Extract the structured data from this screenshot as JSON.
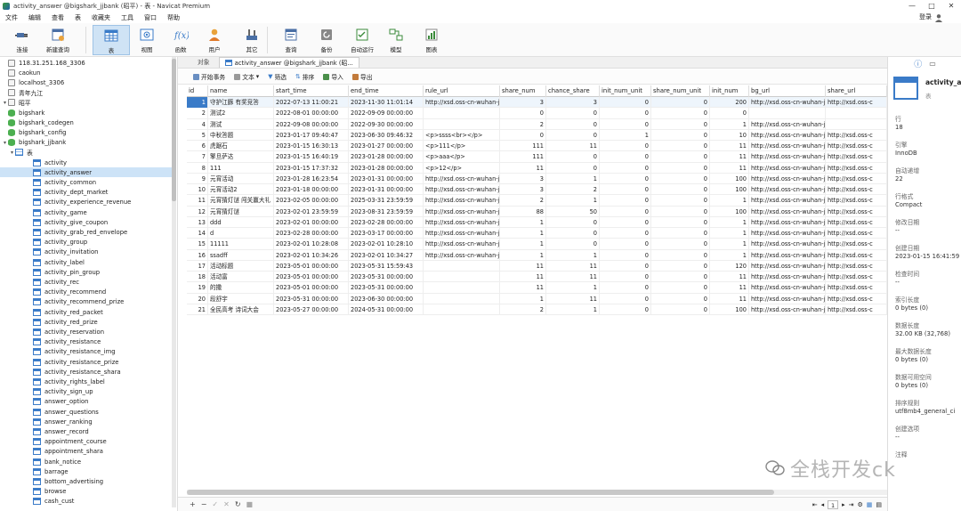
{
  "window": {
    "title": "activity_answer @bigshark_jjbank (昭平) - 表 - Navicat Premium",
    "min": "—",
    "max": "□",
    "close": "✕"
  },
  "menu": [
    "文件",
    "编辑",
    "查看",
    "表",
    "收藏夹",
    "工具",
    "窗口",
    "帮助"
  ],
  "login": "登录",
  "toolbar": {
    "items": [
      "连接",
      "新建查询",
      "表",
      "视图",
      "函数",
      "用户",
      "其它",
      "查询",
      "备份",
      "自动运行",
      "模型",
      "图表"
    ]
  },
  "tree": [
    {
      "label": "118.31.251.168_3306",
      "level": 0,
      "kind": "conn"
    },
    {
      "label": "caokun",
      "level": 0,
      "kind": "conn"
    },
    {
      "label": "localhost_3306",
      "level": 0,
      "kind": "conn"
    },
    {
      "label": "青年九江",
      "level": 0,
      "kind": "conn"
    },
    {
      "label": "昭平",
      "level": 0,
      "kind": "connopen",
      "tw": "▾"
    },
    {
      "label": "bigshark",
      "level": 1,
      "kind": "db"
    },
    {
      "label": "bigshark_codegen",
      "level": 1,
      "kind": "db"
    },
    {
      "label": "bigshark_config",
      "level": 1,
      "kind": "db"
    },
    {
      "label": "bigshark_jjbank",
      "level": 1,
      "kind": "dbopen",
      "tw": "▾"
    },
    {
      "label": "表",
      "level": 2,
      "kind": "tables",
      "tw": "▾"
    },
    {
      "label": "activity",
      "level": 3,
      "kind": "table"
    },
    {
      "label": "activity_answer",
      "level": 3,
      "kind": "table",
      "sel": true
    },
    {
      "label": "activity_common",
      "level": 3,
      "kind": "table"
    },
    {
      "label": "activity_dept_market",
      "level": 3,
      "kind": "table"
    },
    {
      "label": "activity_experience_revenue",
      "level": 3,
      "kind": "table"
    },
    {
      "label": "activity_game",
      "level": 3,
      "kind": "table"
    },
    {
      "label": "activity_give_coupon",
      "level": 3,
      "kind": "table"
    },
    {
      "label": "activity_grab_red_envelope",
      "level": 3,
      "kind": "table"
    },
    {
      "label": "activity_group",
      "level": 3,
      "kind": "table"
    },
    {
      "label": "activity_invitation",
      "level": 3,
      "kind": "table"
    },
    {
      "label": "activity_label",
      "level": 3,
      "kind": "table"
    },
    {
      "label": "activity_pin_group",
      "level": 3,
      "kind": "table"
    },
    {
      "label": "activity_rec",
      "level": 3,
      "kind": "table"
    },
    {
      "label": "activity_recommend",
      "level": 3,
      "kind": "table"
    },
    {
      "label": "activity_recommend_prize",
      "level": 3,
      "kind": "table"
    },
    {
      "label": "activity_red_packet",
      "level": 3,
      "kind": "table"
    },
    {
      "label": "activity_red_prize",
      "level": 3,
      "kind": "table"
    },
    {
      "label": "activity_reservation",
      "level": 3,
      "kind": "table"
    },
    {
      "label": "activity_resistance",
      "level": 3,
      "kind": "table"
    },
    {
      "label": "activity_resistance_img",
      "level": 3,
      "kind": "table"
    },
    {
      "label": "activity_resistance_prize",
      "level": 3,
      "kind": "table"
    },
    {
      "label": "activity_resistance_shara",
      "level": 3,
      "kind": "table"
    },
    {
      "label": "activity_rights_label",
      "level": 3,
      "kind": "table"
    },
    {
      "label": "activity_sign_up",
      "level": 3,
      "kind": "table"
    },
    {
      "label": "answer_option",
      "level": 3,
      "kind": "table"
    },
    {
      "label": "answer_questions",
      "level": 3,
      "kind": "table"
    },
    {
      "label": "answer_ranking",
      "level": 3,
      "kind": "table"
    },
    {
      "label": "answer_record",
      "level": 3,
      "kind": "table"
    },
    {
      "label": "appointment_course",
      "level": 3,
      "kind": "table"
    },
    {
      "label": "appointment_shara",
      "level": 3,
      "kind": "table"
    },
    {
      "label": "bank_notice",
      "level": 3,
      "kind": "table"
    },
    {
      "label": "barrage",
      "level": 3,
      "kind": "table"
    },
    {
      "label": "bottom_advertising",
      "level": 3,
      "kind": "table"
    },
    {
      "label": "browse",
      "level": 3,
      "kind": "table"
    },
    {
      "label": "cash_cust",
      "level": 3,
      "kind": "table"
    }
  ],
  "tabs": {
    "objects": "对象",
    "active": "activity_answer @bigshark_jjbank (昭..."
  },
  "subtoolbar": [
    "开始事务",
    "文本",
    "筛选",
    "排序",
    "导入",
    "导出"
  ],
  "columns": [
    "id",
    "name",
    "start_time",
    "end_time",
    "rule_url",
    "share_num",
    "chance_share",
    "init_num_unit",
    "share_num_unit",
    "init_num",
    "bg_url",
    "share_url"
  ],
  "rows": [
    [
      "1",
      "守护江豚 有奖竞答",
      "2022-07-13 11:00:21",
      "2023-11-30 11:01:14",
      "http://xsd.oss-cn-wuhan-j",
      "3",
      "3",
      "0",
      "0",
      "200",
      "http://xsd.oss-cn-wuhan-j",
      "http://xsd.oss-c"
    ],
    [
      "2",
      "测试2",
      "2022-08-01 00:00:00",
      "2022-09-09 00:00:00",
      "",
      "0",
      "0",
      "0",
      "0",
      "0",
      "",
      ""
    ],
    [
      "4",
      "测试",
      "2022-09-08 00:00:00",
      "2022-09-30 00:00:00",
      "",
      "2",
      "0",
      "0",
      "0",
      "1",
      "http://xsd.oss-cn-wuhan-j",
      ""
    ],
    [
      "5",
      "中秋答题",
      "2023-01-17 09:40:47",
      "2023-06-30 09:46:32",
      "<p>ssss<br></p>",
      "0",
      "0",
      "1",
      "0",
      "10",
      "http://xsd.oss-cn-wuhan-j",
      "http://xsd.oss-c"
    ],
    [
      "6",
      "虎踞石",
      "2023-01-15 16:30:13",
      "2023-01-27 00:00:00",
      "<p>111</p>",
      "111",
      "11",
      "0",
      "0",
      "11",
      "http://xsd.oss-cn-wuhan-j",
      "http://xsd.oss-c"
    ],
    [
      "7",
      "擎旦萨达",
      "2023-01-15 16:40:19",
      "2023-01-28 00:00:00",
      "<p>aaa</p>",
      "111",
      "0",
      "0",
      "0",
      "11",
      "http://xsd.oss-cn-wuhan-j",
      "http://xsd.oss-c"
    ],
    [
      "8",
      "111",
      "2023-01-15 17:37:32",
      "2023-01-28 00:00:00",
      "<p>12</p>",
      "11",
      "0",
      "0",
      "0",
      "11",
      "http://xsd.oss-cn-wuhan-j",
      "http://xsd.oss-c"
    ],
    [
      "9",
      "元宵活动",
      "2023-01-28 16:23:54",
      "2023-01-31 00:00:00",
      "http://xsd.oss-cn-wuhan-j",
      "3",
      "1",
      "0",
      "0",
      "100",
      "http://xsd.oss-cn-wuhan-j",
      "http://xsd.oss-c"
    ],
    [
      "10",
      "元宵活动2",
      "2023-01-18 00:00:00",
      "2023-01-31 00:00:00",
      "http://xsd.oss-cn-wuhan-j",
      "3",
      "2",
      "0",
      "0",
      "100",
      "http://xsd.oss-cn-wuhan-j",
      "http://xsd.oss-c"
    ],
    [
      "11",
      "元宵猜灯谜 闯关赢大礼",
      "2023-02-05 00:00:00",
      "2025-03-31 23:59:59",
      "http://xsd.oss-cn-wuhan-j",
      "2",
      "1",
      "0",
      "0",
      "1",
      "http://xsd.oss-cn-wuhan-j",
      "http://xsd.oss-c"
    ],
    [
      "12",
      "元宵猜灯谜",
      "2023-02-01 23:59:59",
      "2023-08-31 23:59:59",
      "http://xsd.oss-cn-wuhan-j",
      "88",
      "50",
      "0",
      "0",
      "100",
      "http://xsd.oss-cn-wuhan-j",
      "http://xsd.oss-c"
    ],
    [
      "13",
      "ddd",
      "2023-02-01 00:00:00",
      "2023-02-28 00:00:00",
      "http://xsd.oss-cn-wuhan-j",
      "1",
      "0",
      "0",
      "0",
      "1",
      "http://xsd.oss-cn-wuhan-j",
      "http://xsd.oss-c"
    ],
    [
      "14",
      "d",
      "2023-02-28 00:00:00",
      "2023-03-17 00:00:00",
      "http://xsd.oss-cn-wuhan-j",
      "1",
      "0",
      "0",
      "0",
      "1",
      "http://xsd.oss-cn-wuhan-j",
      "http://xsd.oss-c"
    ],
    [
      "15",
      "11111",
      "2023-02-01 10:28:08",
      "2023-02-01 10:28:10",
      "http://xsd.oss-cn-wuhan-j",
      "1",
      "0",
      "0",
      "0",
      "1",
      "http://xsd.oss-cn-wuhan-j",
      "http://xsd.oss-c"
    ],
    [
      "16",
      "ssadff",
      "2023-02-01 10:34:26",
      "2023-02-01 10:34:27",
      "http://xsd.oss-cn-wuhan-j",
      "1",
      "1",
      "0",
      "0",
      "1",
      "http://xsd.oss-cn-wuhan-j",
      "http://xsd.oss-c"
    ],
    [
      "17",
      "活动标题",
      "2023-05-01 00:00:00",
      "2023-05-31 15:59:43",
      "",
      "11",
      "11",
      "0",
      "0",
      "120",
      "http://xsd.oss-cn-wuhan-j",
      "http://xsd.oss-c"
    ],
    [
      "18",
      "活动富",
      "2023-05-01 00:00:00",
      "2023-05-31 00:00:00",
      "",
      "11",
      "11",
      "0",
      "0",
      "11",
      "http://xsd.oss-cn-wuhan-j",
      "http://xsd.oss-c"
    ],
    [
      "19",
      "的撒",
      "2023-05-01 00:00:00",
      "2023-05-31 00:00:00",
      "",
      "11",
      "1",
      "0",
      "0",
      "11",
      "http://xsd.oss-cn-wuhan-j",
      "http://xsd.oss-c"
    ],
    [
      "20",
      "段舒宇",
      "2023-05-31 00:00:00",
      "2023-06-30 00:00:00",
      "",
      "1",
      "11",
      "0",
      "0",
      "11",
      "http://xsd.oss-cn-wuhan-j",
      "http://xsd.oss-c"
    ],
    [
      "21",
      "全民高考 诗词大会",
      "2023-05-27 00:00:00",
      "2024-05-31 00:00:00",
      "",
      "2",
      "1",
      "0",
      "0",
      "100",
      "http://xsd.oss-cn-wuhan-j",
      "http://xsd.oss-c"
    ]
  ],
  "bottom": {
    "add": "+",
    "remove": "−",
    "check": "✓",
    "cancel": "✕",
    "refresh": "↻",
    "stop": "■",
    "page": "1"
  },
  "info": {
    "name": "activity_a",
    "sub": "表",
    "props": [
      {
        "label": "行",
        "value": "18"
      },
      {
        "label": "引擎",
        "value": "InnoDB"
      },
      {
        "label": "自动递增",
        "value": "22"
      },
      {
        "label": "行格式",
        "value": "Compact"
      },
      {
        "label": "修改日期",
        "value": "--"
      },
      {
        "label": "创建日期",
        "value": "2023-01-15 16:41:59"
      },
      {
        "label": "检查时间",
        "value": "--"
      },
      {
        "label": "索引长度",
        "value": "0 bytes (0)"
      },
      {
        "label": "数据长度",
        "value": "32.00 KB (32,768)"
      },
      {
        "label": "最大数据长度",
        "value": "0 bytes (0)"
      },
      {
        "label": "数据可用空间",
        "value": "0 bytes (0)"
      },
      {
        "label": "排序规则",
        "value": "utf8mb4_general_ci"
      },
      {
        "label": "创建选项",
        "value": "--"
      },
      {
        "label": "注释",
        "value": ""
      }
    ]
  },
  "watermark": "全栈开发ck"
}
